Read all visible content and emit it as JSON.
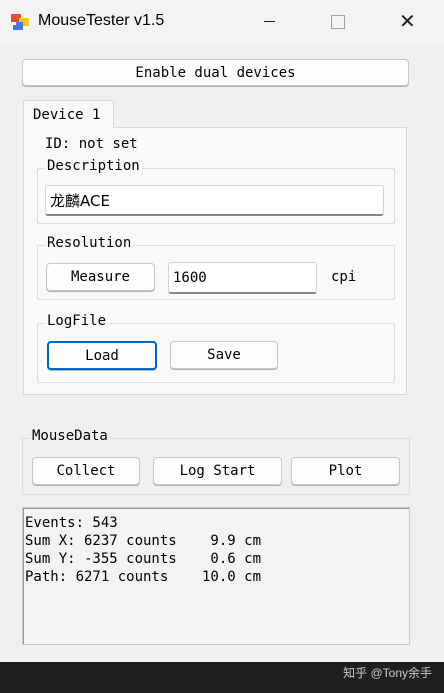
{
  "titlebar": {
    "title": "MouseTester v1.5",
    "close_glyph": "✕"
  },
  "toolbar": {
    "dual_devices_label": "Enable dual devices"
  },
  "tab": {
    "label": "Device 1"
  },
  "device": {
    "id_text": "ID: not set",
    "description_group": "Description",
    "description_value": "龙麟ACE",
    "resolution_group": "Resolution",
    "measure_label": "Measure",
    "resolution_value": "1600",
    "resolution_unit": "cpi",
    "logfile_group": "LogFile",
    "load_label": "Load",
    "save_label": "Save"
  },
  "mousedata": {
    "group": "MouseData",
    "collect_label": "Collect",
    "log_start_label": "Log Start",
    "plot_label": "Plot"
  },
  "output": {
    "lines": [
      "Events: 543",
      "Sum X: 6237 counts    9.9 cm",
      "Sum Y: -355 counts    0.6 cm",
      "Path: 6271 counts    10.0 cm"
    ]
  },
  "watermark": "知乎 @Tony余手",
  "colors": {
    "accent": "#0067c0",
    "window_bg": "#f0f0f0"
  },
  "icons": {
    "app": "app-icon",
    "minimize": "minimize-icon",
    "maximize": "maximize-icon",
    "close": "close-icon"
  }
}
